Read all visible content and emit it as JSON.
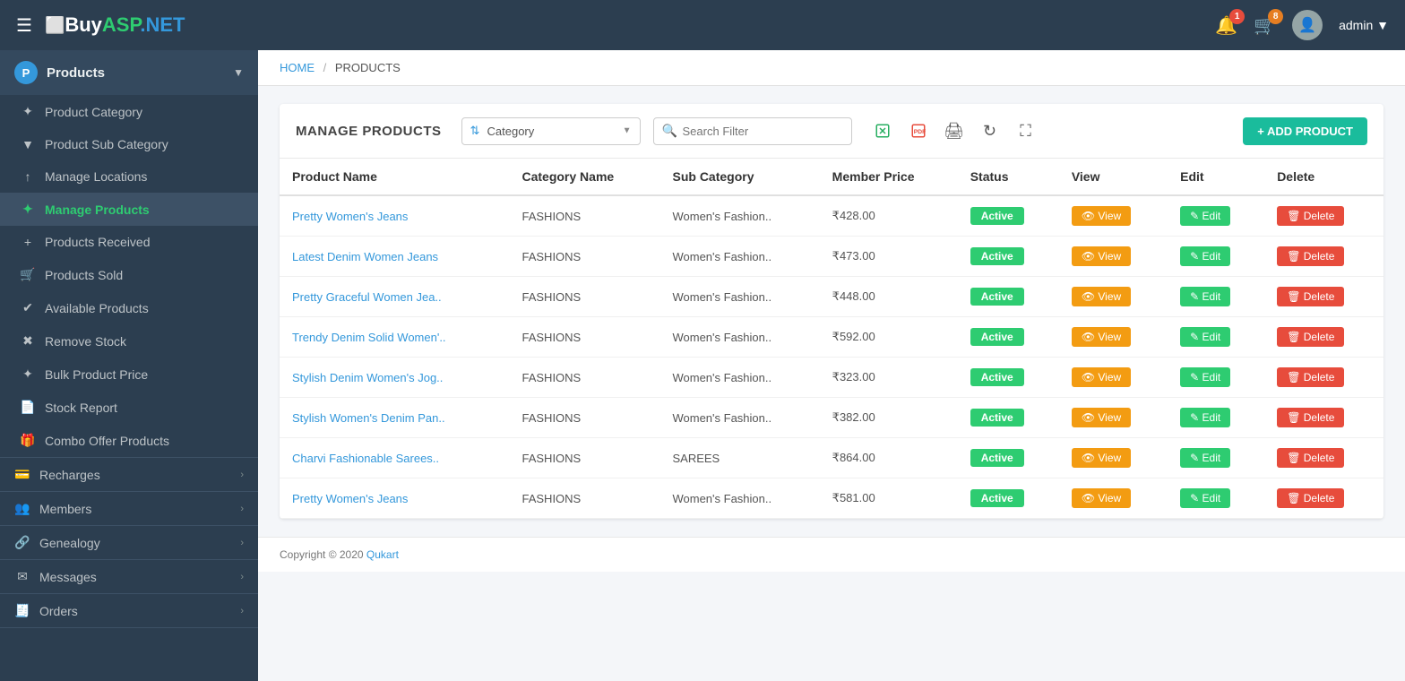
{
  "brand": {
    "buy": "Buy",
    "asp": "ASP",
    "net": ".NET"
  },
  "navbar": {
    "notification_count": "1",
    "cart_count": "8",
    "username": "admin",
    "chevron": "▼"
  },
  "breadcrumb": {
    "home": "HOME",
    "separator": "/",
    "current": "PRODUCTS"
  },
  "sidebar": {
    "products_section": {
      "icon": "P",
      "label": "Products",
      "chevron": "▼",
      "items": [
        {
          "icon": "✦",
          "label": "Product Category"
        },
        {
          "icon": "▼",
          "label": "Product Sub Category"
        },
        {
          "icon": "↑",
          "label": "Manage Locations"
        },
        {
          "icon": "✦",
          "label": "Manage Products",
          "active": true
        },
        {
          "icon": "+",
          "label": "Products Received"
        },
        {
          "icon": "🛒",
          "label": "Products Sold"
        },
        {
          "icon": "✔",
          "label": "Available Products"
        },
        {
          "icon": "✖",
          "label": "Remove Stock"
        },
        {
          "icon": "✦",
          "label": "Bulk Product Price"
        },
        {
          "icon": "📄",
          "label": "Stock Report"
        },
        {
          "icon": "🎁",
          "label": "Combo Offer Products"
        }
      ]
    },
    "recharges": {
      "label": "Recharges",
      "chevron": "›"
    },
    "members": {
      "label": "Members",
      "chevron": "›"
    },
    "genealogy": {
      "label": "Genealogy",
      "chevron": "›"
    },
    "messages": {
      "label": "Messages",
      "chevron": "›"
    },
    "orders": {
      "label": "Orders",
      "chevron": "›"
    }
  },
  "manage_products": {
    "title": "MANAGE PRODUCTS",
    "category_placeholder": "Category",
    "search_placeholder": "Search Filter",
    "add_button": "+ ADD PRODUCT",
    "columns": [
      "Product Name",
      "Category Name",
      "Sub Category",
      "Member Price",
      "Status",
      "View",
      "Edit",
      "Delete"
    ],
    "rows": [
      {
        "name": "Pretty Women's Jeans",
        "category": "FASHIONS",
        "sub_category": "Women's Fashion..",
        "price": "₹428.00",
        "status": "Active"
      },
      {
        "name": "Latest Denim Women Jeans",
        "category": "FASHIONS",
        "sub_category": "Women's Fashion..",
        "price": "₹473.00",
        "status": "Active"
      },
      {
        "name": "Pretty Graceful Women Jea..",
        "category": "FASHIONS",
        "sub_category": "Women's Fashion..",
        "price": "₹448.00",
        "status": "Active"
      },
      {
        "name": "Trendy Denim Solid Women'..",
        "category": "FASHIONS",
        "sub_category": "Women's Fashion..",
        "price": "₹592.00",
        "status": "Active"
      },
      {
        "name": "Stylish Denim Women's Jog..",
        "category": "FASHIONS",
        "sub_category": "Women's Fashion..",
        "price": "₹323.00",
        "status": "Active"
      },
      {
        "name": "Stylish Women's Denim Pan..",
        "category": "FASHIONS",
        "sub_category": "Women's Fashion..",
        "price": "₹382.00",
        "status": "Active"
      },
      {
        "name": "Charvi Fashionable Sarees..",
        "category": "FASHIONS",
        "sub_category": "SAREES",
        "price": "₹864.00",
        "status": "Active"
      },
      {
        "name": "Pretty Women's Jeans",
        "category": "FASHIONS",
        "sub_category": "Women's Fashion..",
        "price": "₹581.00",
        "status": "Active"
      }
    ],
    "btn_view": "View",
    "btn_edit": "Edit",
    "btn_delete": "Delete"
  },
  "footer": {
    "copyright": "Copyright © 2020 ",
    "brand": "Qukart"
  }
}
